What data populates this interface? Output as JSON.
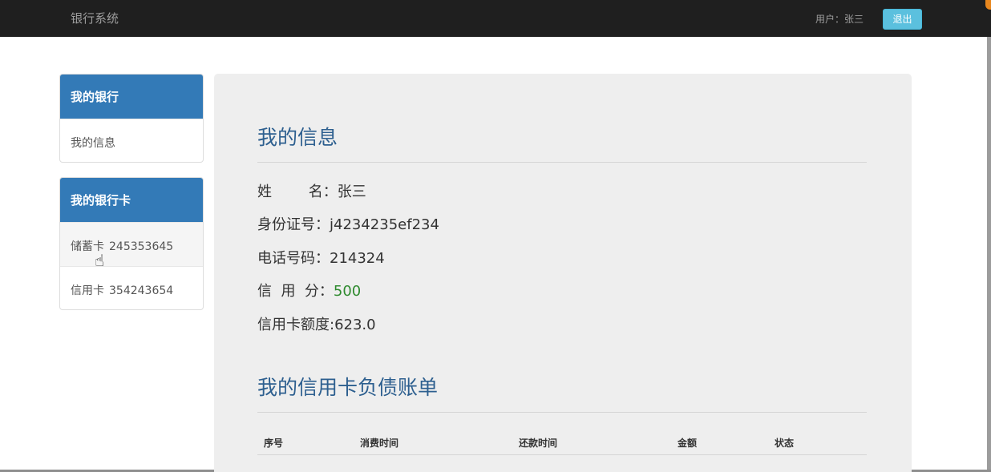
{
  "navbar": {
    "brand": "银行系统",
    "user_label": "用户：张三",
    "logout_label": "退出"
  },
  "sidebar": {
    "panels": [
      {
        "heading": "我的银行",
        "items": [
          {
            "label": "我的信息",
            "number": ""
          }
        ]
      },
      {
        "heading": "我的银行卡",
        "items": [
          {
            "label": "储蓄卡",
            "number": "245353645"
          },
          {
            "label": "信用卡",
            "number": "354243654"
          }
        ]
      }
    ]
  },
  "main": {
    "info_title": "我的信息",
    "info": {
      "name_label": "姓        名：",
      "name_value": "张三",
      "id_label": "身份证号：",
      "id_value": "j4234235ef234",
      "phone_label": "电话号码：",
      "phone_value": "214324",
      "credit_label": "信  用  分：",
      "credit_value": "500",
      "limit_label": "信用卡额度:",
      "limit_value": "623.0"
    },
    "bill_title": "我的信用卡负债账单",
    "bill_headers": [
      "序号",
      "消费时间",
      "还款时间",
      "金额",
      "状态"
    ]
  },
  "colors": {
    "navbar_bg": "#1f1f1f",
    "panel_heading_bg": "#337ab7",
    "logout_bg": "#5bc0de",
    "title_color": "#2d5f8f",
    "credit_score_color": "#2e8a2e"
  }
}
